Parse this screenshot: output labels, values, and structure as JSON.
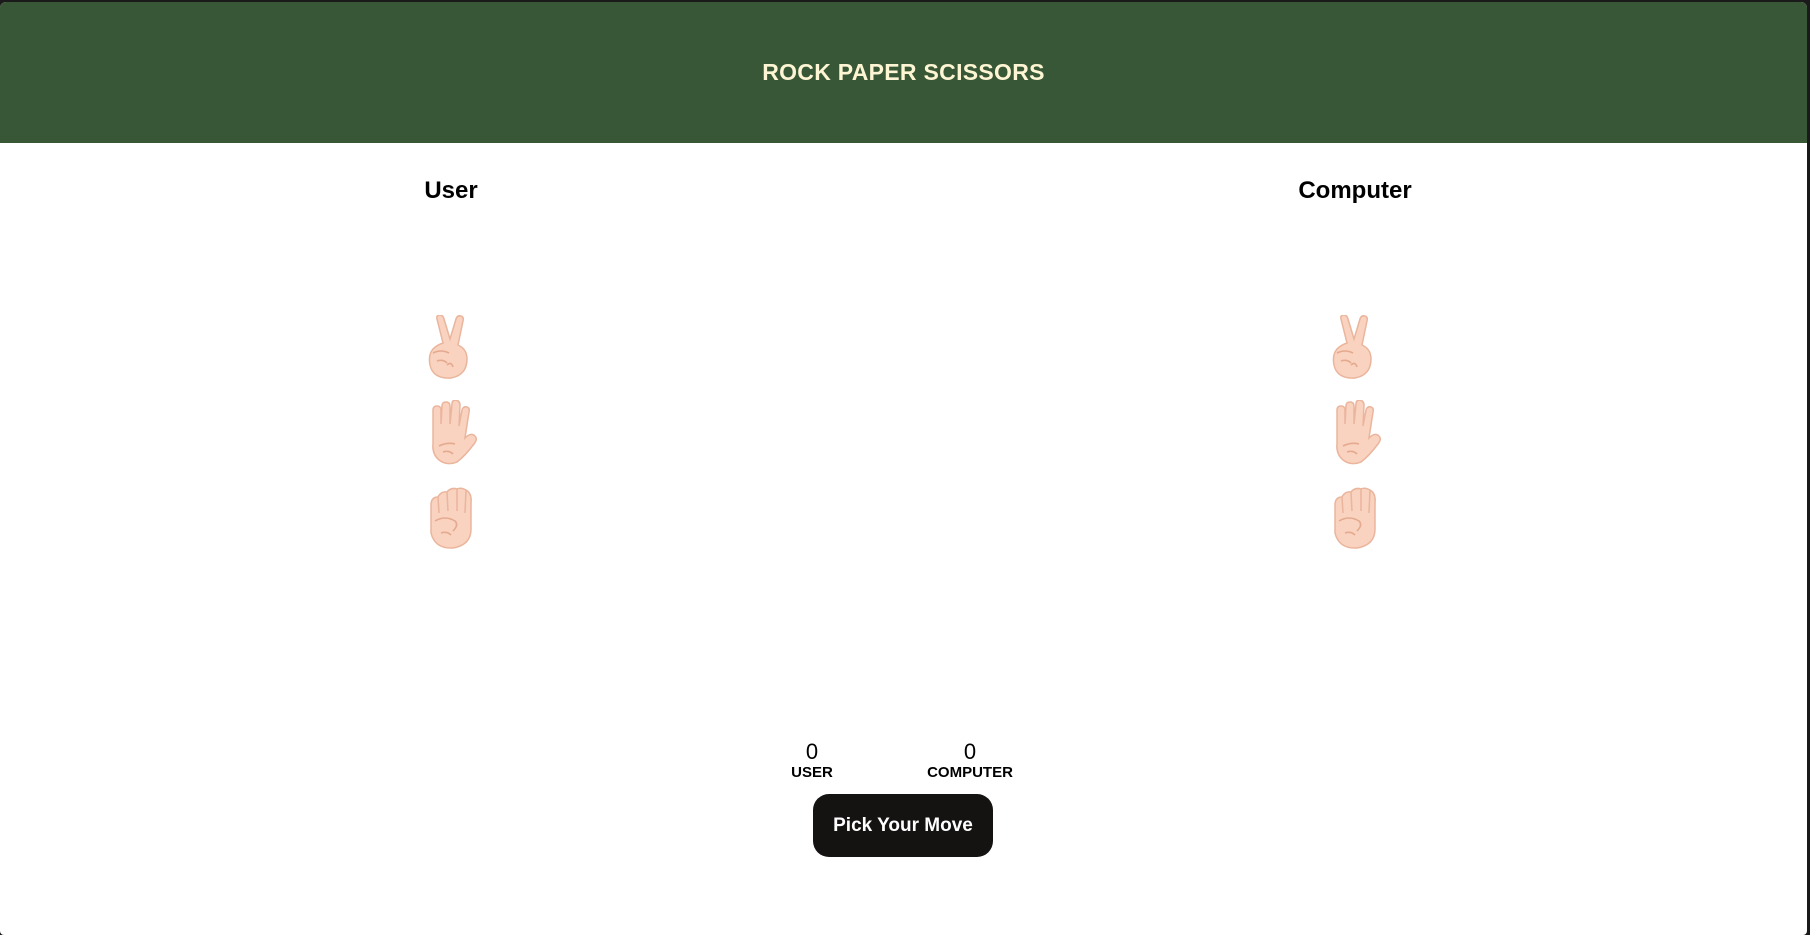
{
  "header": {
    "title": "ROCK PAPER SCISSORS"
  },
  "players": {
    "user": {
      "title": "User"
    },
    "computer": {
      "title": "Computer"
    }
  },
  "hands": [
    "scissors-icon",
    "paper-icon",
    "rock-icon"
  ],
  "scores": {
    "user": {
      "value": "0",
      "label": "USER"
    },
    "computer": {
      "value": "0",
      "label": "COMPUTER"
    }
  },
  "actions": {
    "pick_label": "Pick Your Move"
  },
  "colors": {
    "header_bg": "#375736",
    "header_text": "#fdf5d3",
    "button_bg": "#151212",
    "skin": "#f9d3bf"
  }
}
